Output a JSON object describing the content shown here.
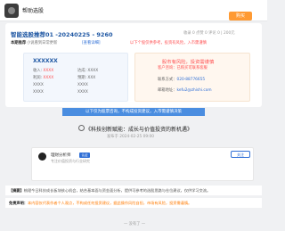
{
  "header": {
    "brand": "帮助选股",
    "action_button": "购买"
  },
  "card": {
    "title": "智能选股推荐01 -20240225 - 9260",
    "meta": "收录 0  点赞 0  评论 0  |  200元",
    "desc_label": "本期推荐",
    "desc_text": "小说看到日常更新",
    "desc_link": "[查看详细]",
    "desc_warning": "以下个股仅供参考，投资有风险，入市需谨慎",
    "left_box": {
      "title": "XXXXXX",
      "row1": {
        "a": "收入",
        "a_val": "XXXX",
        "b": "达成",
        "b_val": "XXXX"
      },
      "row2": {
        "a": "利润",
        "a_val": "XXXX",
        "b": "预期",
        "b_val": "XXX"
      },
      "row3": {
        "a": "XXXX",
        "b": "XXXX"
      },
      "row4": {
        "a": "XXXX",
        "b": "XXXX"
      }
    },
    "right_box": {
      "warning": "股市有风险，投资需谨慎",
      "sub": "客户咨询：已购买可联系客服",
      "row1_label": "联系方式：",
      "row1_val": "020-88776655",
      "row2_label": "邮箱地址：",
      "row2_val": "kefu2@zhishi.com"
    }
  },
  "banner": "以下仅为股票咨询，不构成投资建议，入市需谨慎决策",
  "article": {
    "title": "《科技创新赋能：成长与价值投资的新机遇》",
    "date": "发布于 2024-02-25 09:00"
  },
  "author": {
    "name": "理财分析师",
    "tag": "认证",
    "sub": "专注价值投资与行业研究",
    "follow": "关注"
  },
  "summary": {
    "label": "【摘要】",
    "text": "梳理今日科技成长板块核心机会，结合基本面与资金面分析，提供可参考的选股思路与仓位建议，仅供学习交流。"
  },
  "disclaimer": {
    "label": "免责声明：",
    "text": "本内容仅代表作者个人观点，不构成任何投资建议，据此操作风险自担，市场有风险，投资需谨慎。"
  },
  "footer": "— 没有了 —"
}
